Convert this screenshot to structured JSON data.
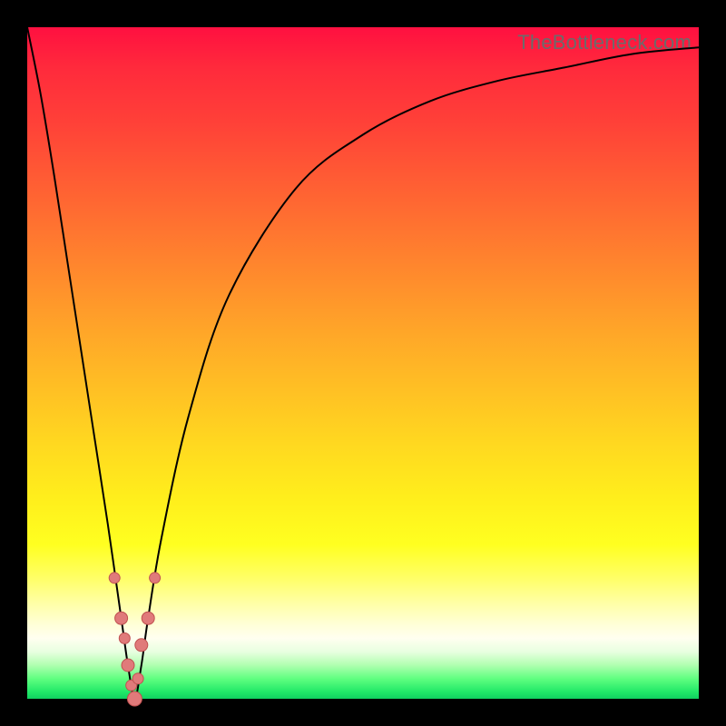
{
  "watermark": "TheBottleneck.com",
  "colors": {
    "frame": "#000000",
    "curve": "#000000",
    "marker_fill": "#e07a7a",
    "marker_stroke": "#c05050",
    "gradient_top": "#ff1040",
    "gradient_bottom": "#10d060"
  },
  "chart_data": {
    "type": "line",
    "title": "",
    "xlabel": "",
    "ylabel": "",
    "xlim": [
      0,
      100
    ],
    "ylim": [
      0,
      100
    ],
    "x_optimum": 16,
    "note": "V-shaped bottleneck curve; y=0 at x≈16, y→100 as x→0 or x→100. No numeric axes shown.",
    "series": [
      {
        "name": "bottleneck-curve",
        "x": [
          0,
          2,
          4,
          6,
          8,
          10,
          12,
          14,
          15,
          16,
          17,
          18,
          20,
          24,
          30,
          40,
          50,
          60,
          70,
          80,
          90,
          100
        ],
        "values": [
          100,
          90,
          78,
          65,
          52,
          39,
          26,
          12,
          5,
          0,
          5,
          12,
          24,
          42,
          60,
          76,
          84,
          89,
          92,
          94,
          96,
          97
        ]
      }
    ],
    "markers": {
      "name": "sample-points",
      "x": [
        13.0,
        14.0,
        14.5,
        15.0,
        15.5,
        16.0,
        16.5,
        17.0,
        18.0,
        19.0
      ],
      "values": [
        18.0,
        12.0,
        9.0,
        5.0,
        2.0,
        0.0,
        3.0,
        8.0,
        12.0,
        18.0
      ],
      "radius": [
        6,
        7,
        6,
        7,
        6,
        8,
        6,
        7,
        7,
        6
      ]
    }
  }
}
